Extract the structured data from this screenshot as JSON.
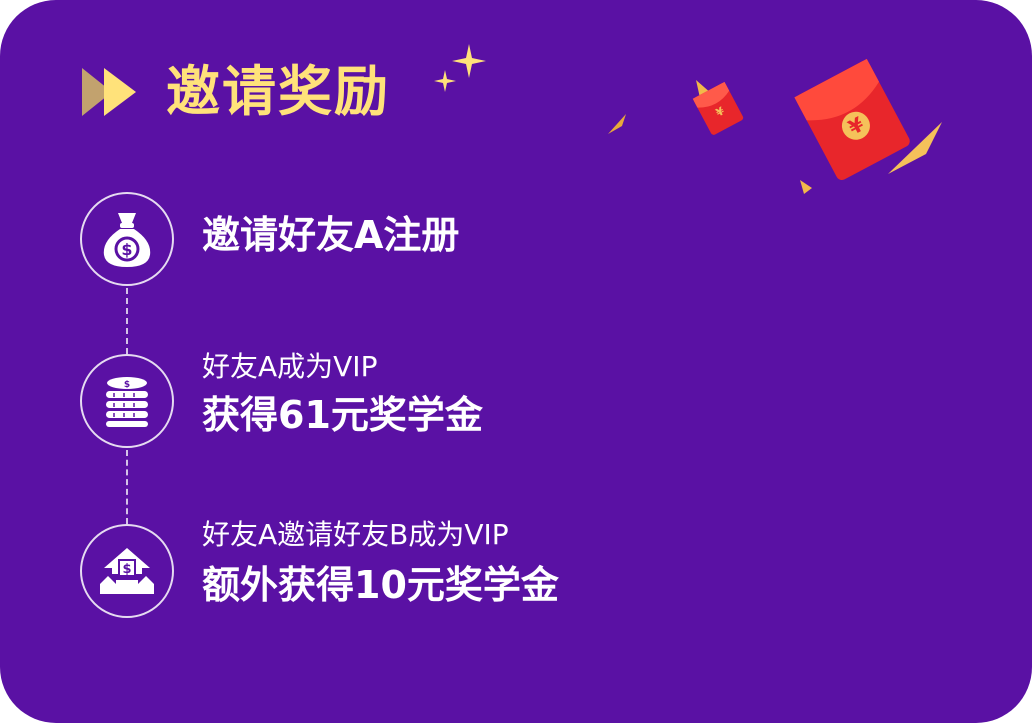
{
  "header": {
    "title": "邀请奖励"
  },
  "steps": [
    {
      "icon": "money-bag-icon",
      "main": "邀请好友A注册"
    },
    {
      "icon": "coin-stack-icon",
      "sub": "好友A成为VIP",
      "main": "获得61元奖学金"
    },
    {
      "icon": "money-house-icon",
      "sub": "好友A邀请好友B成为VIP",
      "main": "额外获得10元奖学金"
    }
  ],
  "envelope": {
    "symbol": "¥"
  },
  "colors": {
    "background": "#5a11a4",
    "title": "#ffe27a",
    "accent_gold": "#f5c15a",
    "envelope_red": "#e8262b",
    "text": "#ffffff"
  }
}
